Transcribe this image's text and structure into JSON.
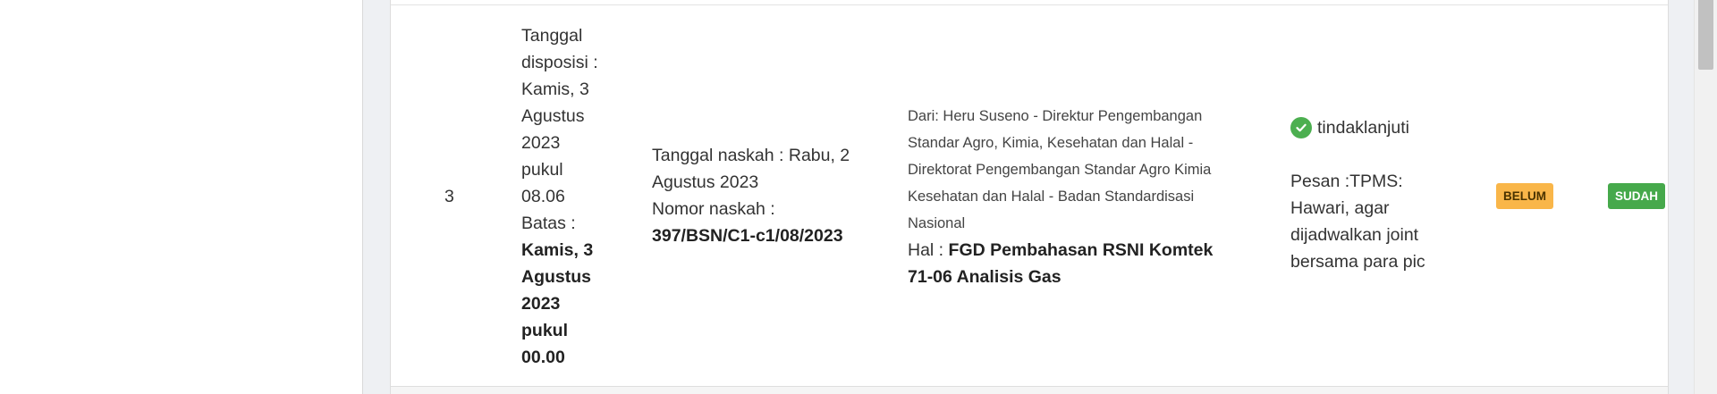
{
  "row": {
    "number": "3",
    "disposisi": {
      "line1": "Tanggal disposisi : Kamis, 3 Agustus 2023 pukul 08.06",
      "batas_label": "Batas :",
      "batas_value": "Kamis, 3 Agustus 2023 pukul 00.00"
    },
    "naskah": {
      "tanggal": "Tanggal naskah : Rabu, 2 Agustus 2023",
      "nomor_label": "Nomor naskah :",
      "nomor_value": "397/BSN/C1-c1/08/2023"
    },
    "dari": {
      "from": "Dari: Heru Suseno - Direktur Pengembangan Standar Agro, Kimia, Kesehatan dan Halal - Direktorat Pengembangan Standar Agro Kimia Kesehatan dan Halal - Badan Standardisasi Nasional",
      "hal_label": "Hal :",
      "hal_value": "FGD Pembahasan RSNI Komtek 71-06 Analisis Gas"
    },
    "tindak": {
      "icon": "check-circle-icon",
      "status": "tindaklanjuti",
      "pesan": "Pesan :TPMS: Hawari, agar dijadwalkan joint bersama para pic"
    },
    "badges": {
      "belum": "BELUM",
      "sudah": "SUDAH"
    }
  },
  "colors": {
    "belum": "#f9b649",
    "sudah": "#46a94b",
    "check": "#4caf50"
  }
}
